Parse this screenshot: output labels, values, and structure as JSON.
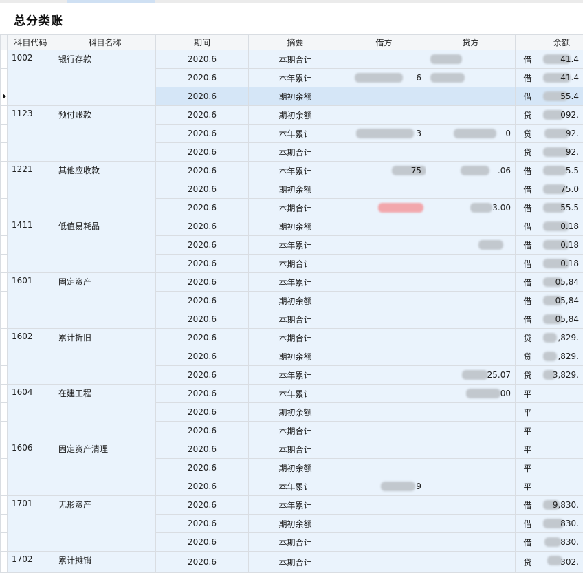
{
  "page": {
    "title": "总分类账"
  },
  "table": {
    "headers": [
      "科目代码",
      "科目名称",
      "期间",
      "摘要",
      "借方",
      "贷方",
      "",
      "余额"
    ],
    "groups": [
      {
        "code": "1002",
        "name": "银行存款",
        "rows": [
          {
            "period": "2020.6",
            "summary": "本期合计",
            "debit": "",
            "credit": "",
            "dir": "借",
            "balance": "41.4"
          },
          {
            "period": "2020.6",
            "summary": "本年累计",
            "debit": "6",
            "credit": "",
            "dir": "借",
            "balance": "41.4"
          },
          {
            "period": "2020.6",
            "summary": "期初余额",
            "debit": "",
            "credit": "",
            "dir": "借",
            "balance": "55.4",
            "selected": true
          }
        ]
      },
      {
        "code": "1123",
        "name": "预付账款",
        "rows": [
          {
            "period": "2020.6",
            "summary": "期初余额",
            "debit": "",
            "credit": "",
            "dir": "贷",
            "balance": "092."
          },
          {
            "period": "2020.6",
            "summary": "本年累计",
            "debit": "3",
            "credit": "0",
            "dir": "贷",
            "balance": "92."
          },
          {
            "period": "2020.6",
            "summary": "本期合计",
            "debit": "",
            "credit": "",
            "dir": "贷",
            "balance": "92."
          }
        ]
      },
      {
        "code": "1221",
        "name": "其他应收款",
        "rows": [
          {
            "period": "2020.6",
            "summary": "本年累计",
            "debit": "75",
            "credit": ".06",
            "dir": "借",
            "balance": "5.5"
          },
          {
            "period": "2020.6",
            "summary": "期初余额",
            "debit": "",
            "credit": "",
            "dir": "借",
            "balance": "75.0"
          },
          {
            "period": "2020.6",
            "summary": "本期合计",
            "debit": "",
            "credit": "3.00",
            "dir": "借",
            "balance": "55.5"
          }
        ]
      },
      {
        "code": "1411",
        "name": "低值易耗品",
        "rows": [
          {
            "period": "2020.6",
            "summary": "期初余额",
            "debit": "",
            "credit": "",
            "dir": "借",
            "balance": "0.18"
          },
          {
            "period": "2020.6",
            "summary": "本年累计",
            "debit": "",
            "credit": "",
            "dir": "借",
            "balance": "0.18"
          },
          {
            "period": "2020.6",
            "summary": "本期合计",
            "debit": "",
            "credit": "",
            "dir": "借",
            "balance": "0.18"
          }
        ]
      },
      {
        "code": "1601",
        "name": "固定资产",
        "rows": [
          {
            "period": "2020.6",
            "summary": "本年累计",
            "debit": "",
            "credit": "",
            "dir": "借",
            "balance": "05,84"
          },
          {
            "period": "2020.6",
            "summary": "期初余额",
            "debit": "",
            "credit": "",
            "dir": "借",
            "balance": "05,84"
          },
          {
            "period": "2020.6",
            "summary": "本期合计",
            "debit": "",
            "credit": "",
            "dir": "借",
            "balance": "05,84"
          }
        ]
      },
      {
        "code": "1602",
        "name": "累计折旧",
        "rows": [
          {
            "period": "2020.6",
            "summary": "本期合计",
            "debit": "",
            "credit": "",
            "dir": "贷",
            "balance": ",829."
          },
          {
            "period": "2020.6",
            "summary": "期初余额",
            "debit": "",
            "credit": "",
            "dir": "贷",
            "balance": ",829."
          },
          {
            "period": "2020.6",
            "summary": "本年累计",
            "debit": "",
            "credit": "25.07",
            "dir": "贷",
            "balance": "3,829."
          }
        ]
      },
      {
        "code": "1604",
        "name": "在建工程",
        "rows": [
          {
            "period": "2020.6",
            "summary": "本年累计",
            "debit": "",
            "credit": "00",
            "dir": "平",
            "balance": ""
          },
          {
            "period": "2020.6",
            "summary": "期初余额",
            "debit": "",
            "credit": "",
            "dir": "平",
            "balance": ""
          },
          {
            "period": "2020.6",
            "summary": "本期合计",
            "debit": "",
            "credit": "",
            "dir": "平",
            "balance": ""
          }
        ]
      },
      {
        "code": "1606",
        "name": "固定资产清理",
        "rows": [
          {
            "period": "2020.6",
            "summary": "本期合计",
            "debit": "",
            "credit": "",
            "dir": "平",
            "balance": ""
          },
          {
            "period": "2020.6",
            "summary": "期初余额",
            "debit": "",
            "credit": "",
            "dir": "平",
            "balance": ""
          },
          {
            "period": "2020.6",
            "summary": "本年累计",
            "debit": "9",
            "credit": "",
            "dir": "平",
            "balance": ""
          }
        ]
      },
      {
        "code": "1701",
        "name": "无形资产",
        "rows": [
          {
            "period": "2020.6",
            "summary": "本年累计",
            "debit": "",
            "credit": "",
            "dir": "借",
            "balance": "9,830."
          },
          {
            "period": "2020.6",
            "summary": "期初余额",
            "debit": "",
            "credit": "",
            "dir": "借",
            "balance": "830."
          },
          {
            "period": "2020.6",
            "summary": "本期合计",
            "debit": "",
            "credit": "",
            "dir": "借",
            "balance": "830."
          }
        ]
      },
      {
        "code": "1702",
        "name": "累计摊销",
        "rows": [
          {
            "period": "2020.6",
            "summary": "本期合计",
            "debit": "",
            "credit": "",
            "dir": "贷",
            "balance": "302."
          }
        ]
      }
    ]
  }
}
